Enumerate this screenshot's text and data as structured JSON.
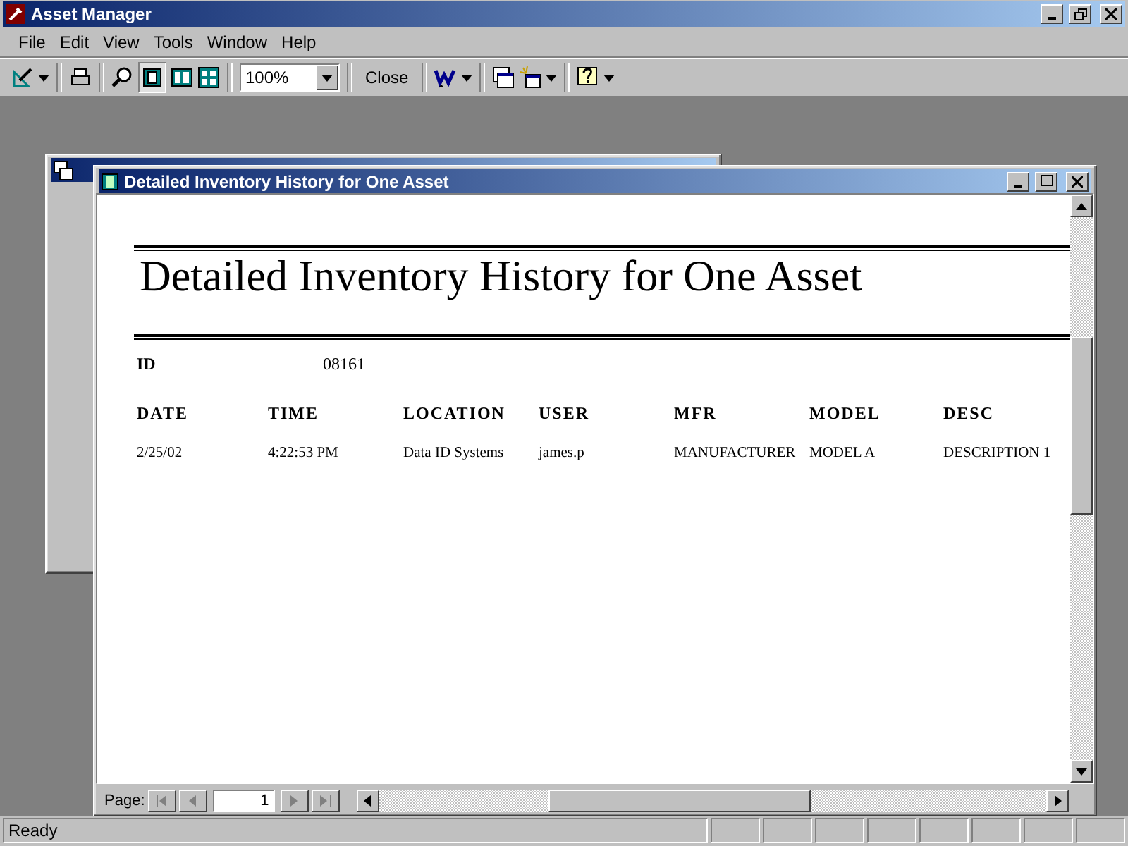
{
  "window": {
    "title": "Asset Manager"
  },
  "menu": [
    "File",
    "Edit",
    "View",
    "Tools",
    "Window",
    "Help"
  ],
  "toolbar": {
    "zoom": "100%",
    "close": "Close"
  },
  "report_window": {
    "title": "Detailed Inventory History for One Asset"
  },
  "report": {
    "title": "Detailed Inventory History for One Asset",
    "id_label": "ID",
    "id_value": "08161",
    "columns": [
      "DATE",
      "TIME",
      "LOCATION",
      "USER",
      "MFR",
      "MODEL",
      "DESC"
    ],
    "rows": [
      [
        "2/25/02",
        "4:22:53 PM",
        "Data ID Systems",
        "james.p",
        "MANUFACTURER",
        "MODEL A",
        "DESCRIPTION 1"
      ]
    ]
  },
  "pager": {
    "label": "Page:",
    "page": "1"
  },
  "status_bar": {
    "text": "Ready"
  }
}
